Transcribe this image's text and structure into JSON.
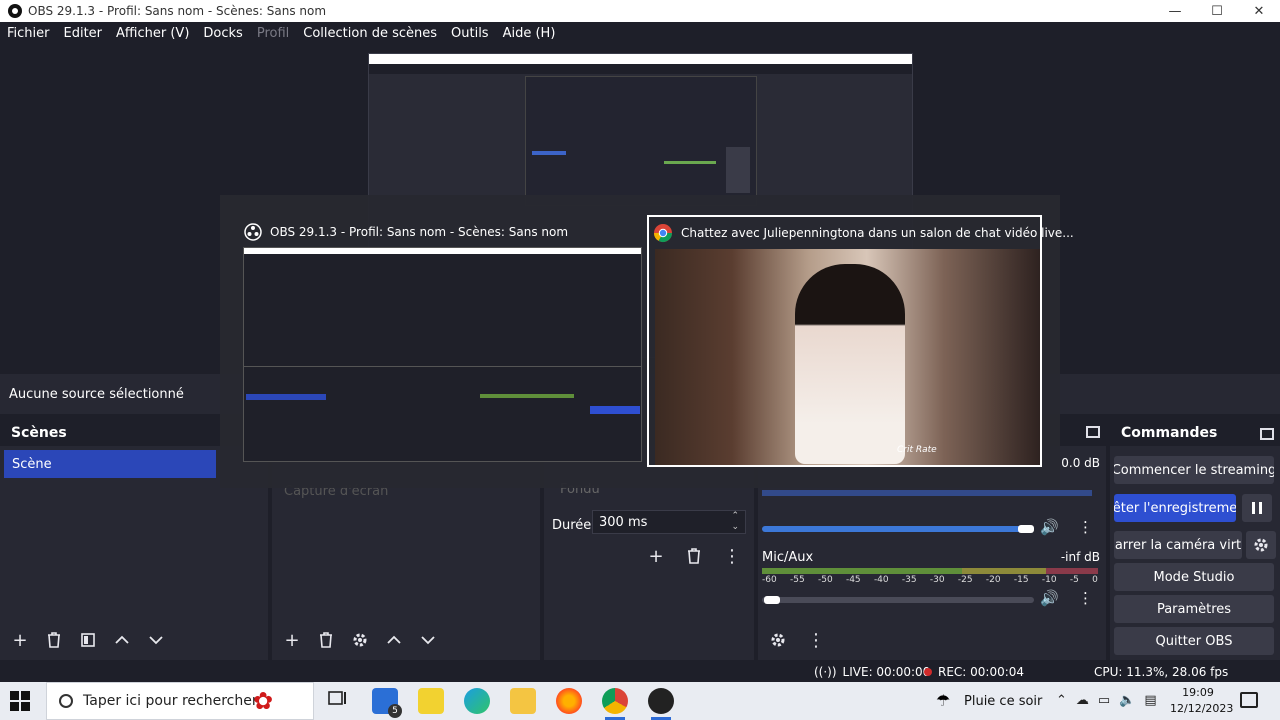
{
  "window": {
    "title": "OBS 29.1.3 - Profil: Sans nom - Scènes: Sans nom",
    "minimize": "—",
    "maximize": "☐",
    "close": "✕"
  },
  "menu": [
    {
      "label": "Fichier",
      "disabled": false
    },
    {
      "label": "Editer",
      "disabled": false
    },
    {
      "label": "Afficher (V)",
      "disabled": false
    },
    {
      "label": "Docks",
      "disabled": false
    },
    {
      "label": "Profil",
      "disabled": true
    },
    {
      "label": "Collection de scènes",
      "disabled": false
    },
    {
      "label": "Outils",
      "disabled": false
    },
    {
      "label": "Aide (H)",
      "disabled": false
    }
  ],
  "source_bar": {
    "no_source": "Aucune source sélectionné"
  },
  "scenes": {
    "header": "Scènes",
    "items": [
      "Scène"
    ]
  },
  "sources": {
    "item": "Capture d'écran"
  },
  "transitions": {
    "current": "Fondu",
    "duration_label": "Durée",
    "duration_value": "300 ms"
  },
  "mixer": {
    "track1": {
      "db": "0.0 dB"
    },
    "track2": {
      "name": "Mic/Aux",
      "db": "-inf dB"
    },
    "scale": [
      "-60",
      "-55",
      "-50",
      "-45",
      "-40",
      "-35",
      "-30",
      "-25",
      "-20",
      "-15",
      "-10",
      "-5",
      "0"
    ]
  },
  "controls": {
    "header": "Commandes",
    "start_streaming": "Commencer le streaming",
    "stop_recording": "êter l'enregistreme",
    "virtual_camera": "arrer la caméra virt",
    "studio_mode": "Mode Studio",
    "settings": "Paramètres",
    "quit": "Quitter OBS"
  },
  "status": {
    "live": "LIVE: 00:00:00",
    "rec": "REC: 00:00:04",
    "cpu": "CPU: 11.3%, 28.06 fps"
  },
  "alttab": {
    "obs_title": "OBS 29.1.3 - Profil: Sans nom - Scènes: Sans nom",
    "chrome_title": "Chattez avec Juliepenningtona dans un salon de chat vidéo live...",
    "video_badge": "Crit Rate"
  },
  "taskbar": {
    "search_placeholder": "Taper ici pour rechercher",
    "mail_badge": "5",
    "weather": "Pluie ce soir",
    "time": "19:09",
    "date": "12/12/2023"
  },
  "colors": {
    "accent": "#2e4fd1",
    "scene_selected": "#2b47b8",
    "rec_red": "#d02a2a",
    "bg_dark": "#1e1f29",
    "panel": "#272833"
  }
}
